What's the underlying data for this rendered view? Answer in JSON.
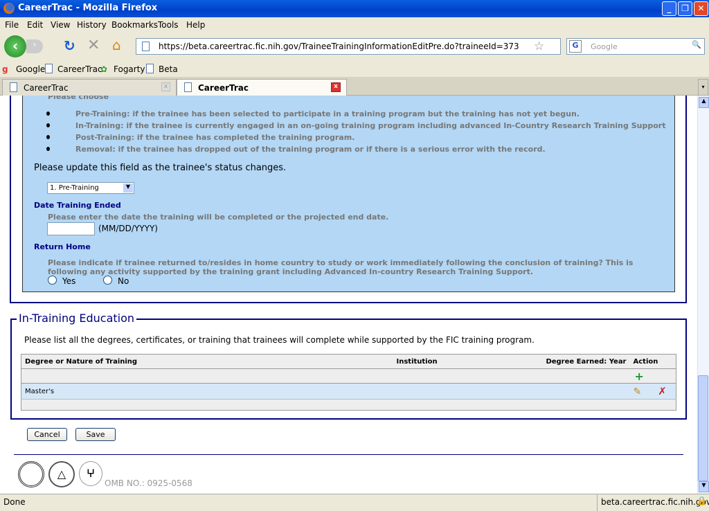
{
  "window": {
    "title": "CareerTrac - Mozilla Firefox"
  },
  "menu": [
    "File",
    "Edit",
    "View",
    "History",
    "Bookmarks",
    "Tools",
    "Help"
  ],
  "address": {
    "url": "https://beta.careertrac.fic.nih.gov/TraineeTrainingInformationEditPre.do?traineeId=373"
  },
  "search": {
    "placeholder": "Google"
  },
  "bookmarks": [
    "Google",
    "CareerTrac",
    "Fogarty",
    "Beta"
  ],
  "tabs": [
    {
      "label": "CareerTrac",
      "active": false
    },
    {
      "label": "CareerTrac",
      "active": true
    }
  ],
  "status_section": {
    "choose": "Please choose",
    "bullets": [
      "Pre-Training: if the trainee has been selected to participate in a training program but the training has not yet begun.",
      "In-Training: if the trainee is currently engaged in an on-going training program including advanced In-Country Research Training Support",
      "Post-Training: if the trainee has completed the training program.",
      "Removal: if the trainee has dropped out of the training program or if there is a serious error with the record."
    ],
    "update_note": "Please update this field as the trainee's status changes.",
    "selected": "1. Pre-Training"
  },
  "date_ended": {
    "label": "Date Training Ended",
    "help": "Please enter the date the training will be completed or the projected end date.",
    "value": "",
    "format": "(MM/DD/YYYY)"
  },
  "return_home": {
    "label": "Return Home",
    "help": "Please indicate if trainee returned to/resides in home country to study or work immediately following the conclusion of training? This is following any activity supported by the training grant including Advanced In-country Research Training Support.",
    "yes": "Yes",
    "no": "No"
  },
  "education": {
    "legend": "In-Training Education",
    "intro": "Please list all the degrees, certificates, or training that trainees will complete while supported by the FIC training program.",
    "headers": [
      "Degree or Nature of Training",
      "Institution",
      "Degree Earned: Year",
      "Action"
    ],
    "rows": [
      {
        "degree": "Master's",
        "institution": "",
        "year": ""
      }
    ]
  },
  "buttons": {
    "cancel": "Cancel",
    "save": "Save"
  },
  "footer": {
    "omb": "OMB NO.: 0925-0568"
  },
  "statusbar": {
    "text": "Done",
    "domain": "beta.careertrac.fic.nih.gov"
  }
}
